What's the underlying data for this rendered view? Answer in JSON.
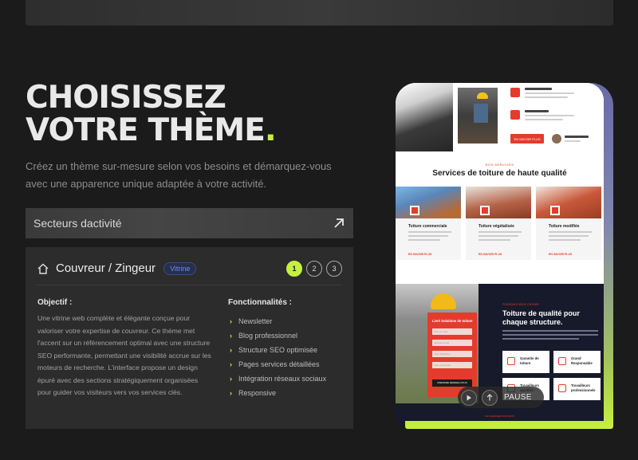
{
  "hero": {
    "title_line1": "CHOISISSEZ",
    "title_line2": "VOTRE THÈME",
    "title_dot": ".",
    "subtitle": "Créez un thème sur-mesure selon vos besoins et démarquez-vous avec une apparence unique adaptée à votre activité."
  },
  "sector_select": {
    "label": "Secteurs dactivité",
    "icon": "arrow-up-right-icon"
  },
  "theme_card": {
    "name": "Couvreur / Zingeur",
    "tag": "Vitrine",
    "steps": [
      "1",
      "2",
      "3"
    ],
    "active_step": "1",
    "objective_title": "Objectif :",
    "objective_text": "Une vitrine web complète et élégante conçue pour valoriser votre expertise de couvreur. Ce thème met l'accent sur un référencement optimal avec une structure SEO performante, permettant une visibilité accrue sur les moteurs de recherche. L'interface propose un design épuré avec des sections stratégiquement organisées pour guider vos visiteurs vers vos services clés.",
    "features_title": "Fonctionnalités :",
    "features": [
      "Newsletter",
      "Blog professionnel",
      "Structure SEO optimisée",
      "Pages services détaillées",
      "Intégration réseaux sociaux",
      "Responsive"
    ]
  },
  "preview": {
    "services_kicker": "NOS SERVICES",
    "services_title": "Services de toiture de haute qualité",
    "cards": [
      {
        "title": "Toiture commerciale",
        "more": "EN SAVOIR PLUS"
      },
      {
        "title": "Toiture végétalisée",
        "more": "EN SAVOIR PLUS"
      },
      {
        "title": "Toiture modifiée",
        "more": "EN SAVOIR PLUS"
      }
    ],
    "top_items": [
      {
        "title": "Matériel de qualité"
      },
      {
        "title": "Ingénieur expert"
      }
    ],
    "top_button": "EN SAVOIR PLUS",
    "author": "Ronald Richards",
    "form_title": "Livré Solutions de toiture",
    "form_fields": [
      "Nom complet",
      "Adresse email",
      "Votre téléphone",
      "Votre entreprise"
    ],
    "form_button": "PRENDRE RENDEZ-VOUS",
    "quality_kicker": "POURQUOI NOUS CHOISIR",
    "quality_title": "Toiture de qualité pour chaque structure.",
    "quality_features": [
      "Garantie de toiture",
      "Grand Responsable",
      "Travailleurs qualifiés",
      "Travailleurs professionnels"
    ],
    "footer_kicker": "NOS DERNIERS PROJETS"
  },
  "player": {
    "pause_label": "PAUSE"
  },
  "colors": {
    "accent": "#c6f03f",
    "brand_red": "#e33c2c",
    "tag_blue": "#6d8ee8"
  }
}
